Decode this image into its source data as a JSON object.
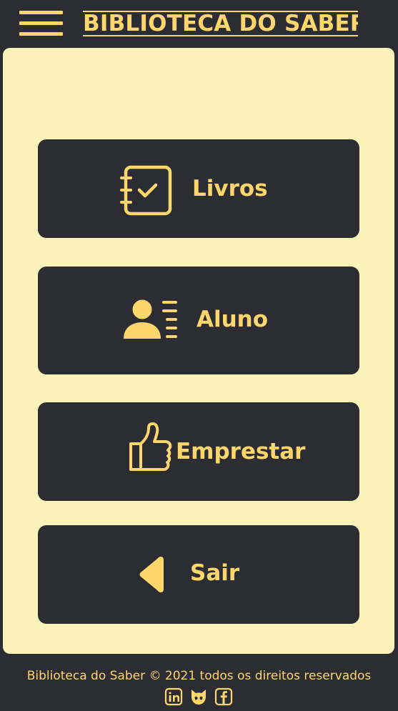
{
  "header": {
    "menu_icon": "hamburger-icon",
    "title": "BIBLIOTECA DO SABER"
  },
  "menu": {
    "items": [
      {
        "label": "Livros",
        "icon": "checklist-notebook-icon"
      },
      {
        "label": "Aluno",
        "icon": "user-list-icon"
      },
      {
        "label": "Emprestar",
        "icon": "thumbs-up-icon"
      },
      {
        "label": "Sair",
        "icon": "back-arrow-icon"
      }
    ]
  },
  "footer": {
    "text": "Biblioteca do Saber © 2021 todos os direitos reservados",
    "social": [
      "linkedin-icon",
      "github-icon",
      "facebook-icon"
    ]
  },
  "colors": {
    "background": "#2b2d32",
    "accent": "#ffd66b",
    "panel": "#fcf3bb"
  }
}
